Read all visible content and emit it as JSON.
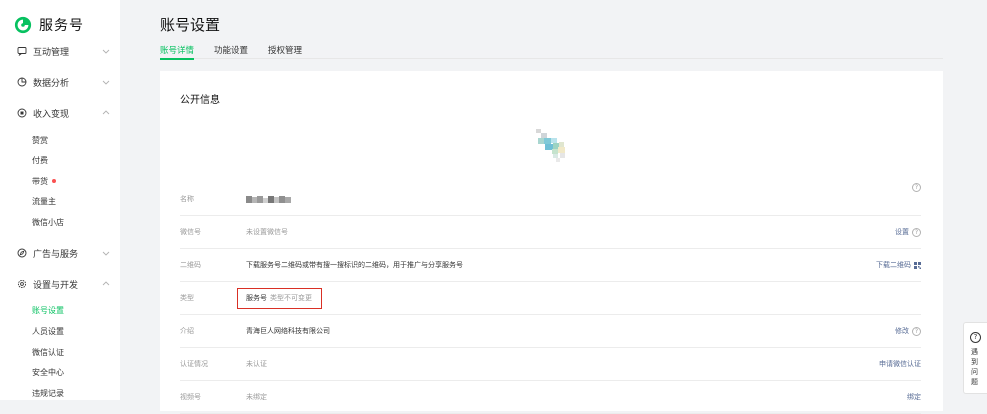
{
  "brand": {
    "name": "服务号",
    "color": "#07c160"
  },
  "sidebar": {
    "groups": [
      {
        "label": "互动管理",
        "icon": "message-icon"
      },
      {
        "label": "数据分析",
        "icon": "chart-icon"
      },
      {
        "label": "收入变现",
        "icon": "money-icon"
      },
      {
        "label": "广告与服务",
        "icon": "compass-icon"
      },
      {
        "label": "设置与开发",
        "icon": "gear-icon"
      }
    ],
    "income_items": [
      "赞赏",
      "付费",
      "带货",
      "流量主",
      "微信小店"
    ],
    "settings_items": [
      "账号设置",
      "人员设置",
      "微信认证",
      "安全中心",
      "违规记录"
    ]
  },
  "page": {
    "title": "账号设置"
  },
  "tabs": [
    "账号详情",
    "功能设置",
    "授权管理"
  ],
  "card": {
    "title": "公开信息",
    "rows": {
      "name": {
        "label": "名称"
      },
      "wechat_id": {
        "label": "微信号",
        "value": "未设置微信号",
        "action": "设置"
      },
      "qrcode": {
        "label": "二维码",
        "value": "下载服务号二维码或带有搜一搜标识的二维码，用于推广与分享服务号",
        "action": "下载二维码"
      },
      "type": {
        "label": "类型",
        "value": "服务号",
        "note": "类型不可变更"
      },
      "intro": {
        "label": "介绍",
        "value": "青海巨人网络科技有限公司",
        "action": "修改"
      },
      "verify": {
        "label": "认证情况",
        "value": "未认证",
        "action": "申请微信认证"
      },
      "channels": {
        "label": "视频号",
        "value": "未绑定",
        "action": "绑定"
      }
    }
  },
  "help": {
    "text": "遇到问题"
  },
  "colors": {
    "accent": "#07c160",
    "link": "#576b95",
    "highlight_box": "#d93025"
  }
}
